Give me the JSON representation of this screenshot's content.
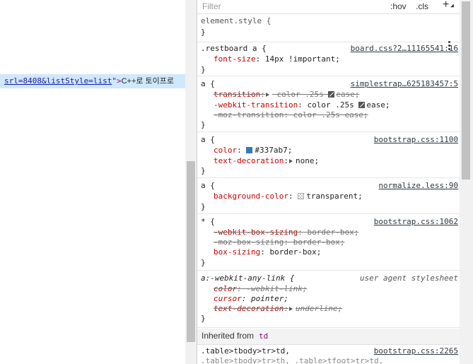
{
  "dom": {
    "attr_value": "srl=8408&listStyle=list",
    "quote": "\"",
    "tag_close": ">",
    "text": "C++로 토이프로"
  },
  "toolbar": {
    "filter_placeholder": "Filter",
    "hov": ":hov",
    "cls": ".cls",
    "add": "+"
  },
  "rules": [
    {
      "selector": "element.style {",
      "close": "}"
    },
    {
      "selector": ".restboard a {",
      "source": "board.css?2…11165541:16",
      "props": [
        {
          "name": "font-size",
          "value": " 14px !important;"
        }
      ],
      "close": "}"
    },
    {
      "selector": "a {",
      "source": "simplestrap…625183457:5",
      "props": [
        {
          "name": "transition",
          "value": " color .25s ",
          "value2": "ease;"
        },
        {
          "name": "-webkit-transition",
          "value": " color .25s ",
          "value2": "ease;"
        },
        {
          "name": "-moz-transition",
          "value": " color .25s ease;"
        }
      ],
      "close": "}"
    },
    {
      "selector": "a {",
      "source": "bootstrap.css:1100",
      "props": [
        {
          "name": "color",
          "value": "#337ab7;"
        },
        {
          "name": "text-decoration",
          "value": "none;"
        }
      ],
      "close": "}"
    },
    {
      "selector": "a {",
      "source": "normalize.less:90",
      "props": [
        {
          "name": "background-color",
          "value": "transparent;"
        }
      ],
      "close": "}"
    },
    {
      "selector": "* {",
      "source": "bootstrap.css:1062",
      "props": [
        {
          "name": "-webkit-box-sizing",
          "value": " border-box;"
        },
        {
          "name": "-moz-box-sizing",
          "value": " border-box;"
        },
        {
          "name": "box-sizing",
          "value": " border-box;"
        }
      ],
      "close": "}"
    },
    {
      "selector": "a:-webkit-any-link {",
      "source": "user agent stylesheet",
      "props": [
        {
          "name": "color",
          "value": " -webkit-link;"
        },
        {
          "name": "cursor",
          "value": " pointer;"
        },
        {
          "name": "text-decoration",
          "value": "underline;"
        }
      ],
      "close": "}"
    },
    {
      "selector": ".table>tbody>tr>td,",
      "selector2": ".table>tbody>tr>th, .table>tfoot>tr>td,",
      "source": "bootstrap.css:2265"
    }
  ],
  "inherited": {
    "label": "Inherited from",
    "tag": "td"
  },
  "colors": {
    "link_color": "#337ab7",
    "selected_row": "#cfe8fc",
    "prop_name": "#c80000",
    "tag": "#881280"
  }
}
